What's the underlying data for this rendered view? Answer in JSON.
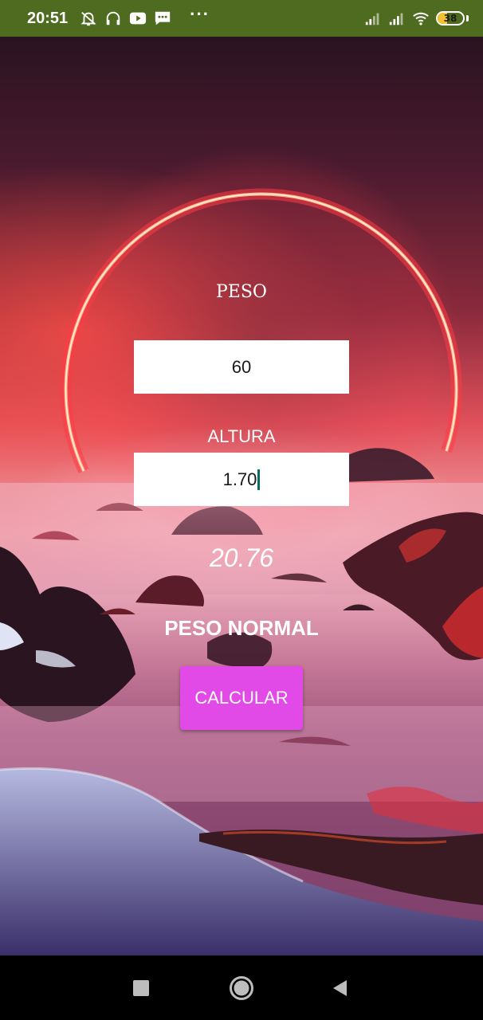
{
  "status_bar": {
    "time": "20:51",
    "battery_level": "38",
    "battery_fraction": 0.38,
    "left_icons": [
      "muted-bell-icon",
      "headset-icon",
      "youtube-icon",
      "message-icon"
    ],
    "right_icons": [
      "signal-icon",
      "signal-icon",
      "wifi-icon",
      "battery-icon"
    ],
    "background_color": "#4f6b1f"
  },
  "form": {
    "peso_label": "PESO",
    "weight_value": "60",
    "altura_label": "ALTURA",
    "height_value": "1.70",
    "imc_result": "20.76",
    "imc_category": "PESO NORMAL",
    "calculate_label": "CALCULAR",
    "button_color": "#e24ae8"
  },
  "nav_bar": {
    "icons": [
      "recents-icon",
      "home-icon",
      "back-icon"
    ]
  }
}
